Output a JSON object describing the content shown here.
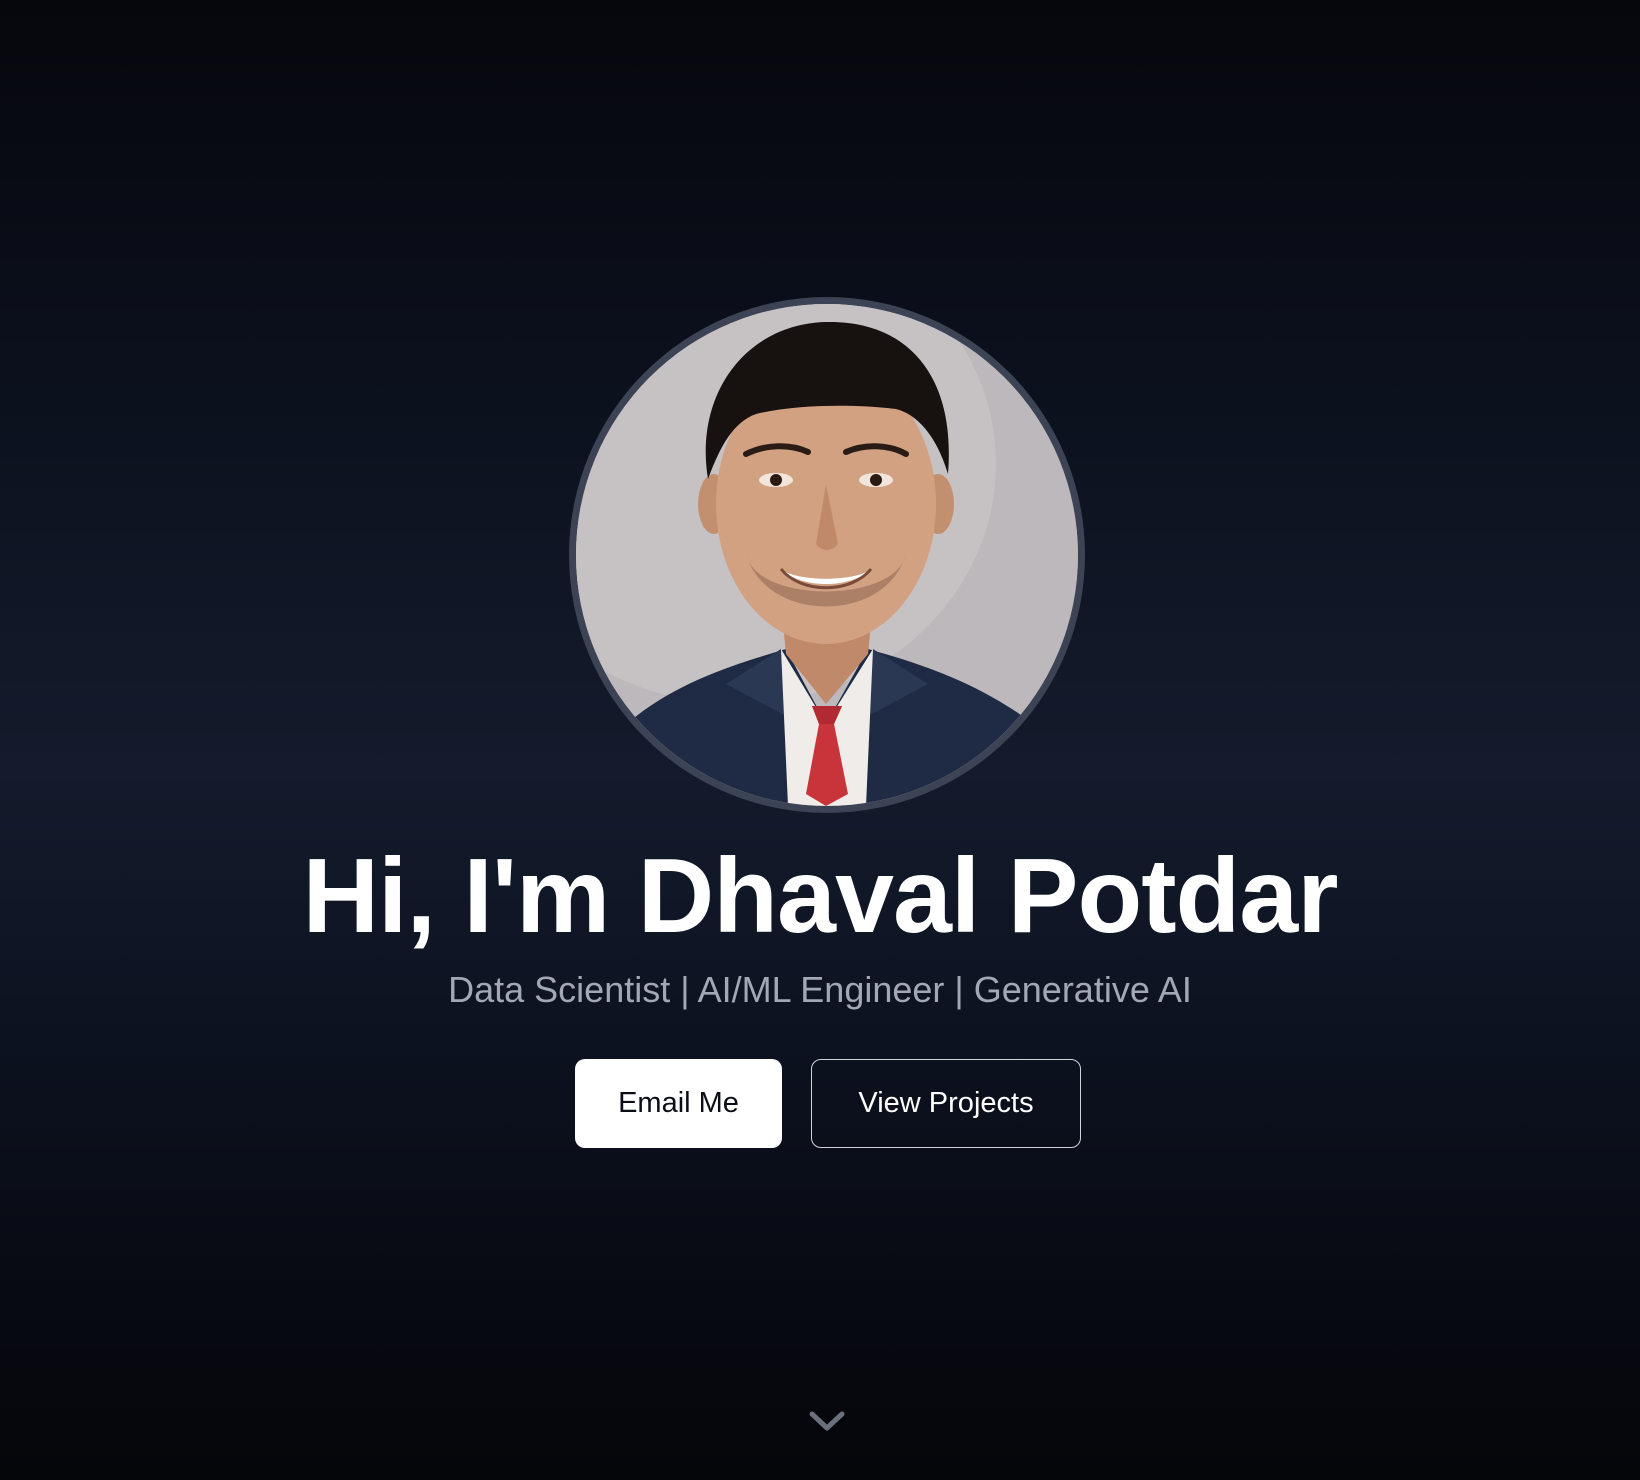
{
  "hero": {
    "title": "Hi, I'm Dhaval Potdar",
    "subtitle": "Data Scientist | AI/ML Engineer | Generative AI",
    "avatar_alt": "Portrait of Dhaval Potdar",
    "buttons": {
      "email_label": "Email Me",
      "projects_label": "View Projects"
    },
    "scroll_icon": "chevron-down-icon"
  },
  "colors": {
    "background_top": "#06070c",
    "background_mid": "#131b2c",
    "title": "#ffffff",
    "subtitle": "#a2a8b4",
    "primary_button_bg": "#ffffff",
    "primary_button_text": "#0b0e16",
    "outline_button_border": "#cfd3da",
    "avatar_ring": "#3b4354"
  }
}
